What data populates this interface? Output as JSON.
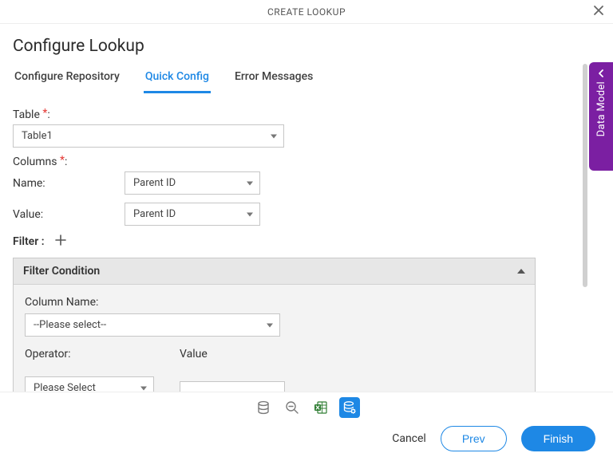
{
  "titlebar": {
    "title": "CREATE LOOKUP"
  },
  "page": {
    "title": "Configure Lookup"
  },
  "tabs": [
    {
      "label": "Configure Repository"
    },
    {
      "label": "Quick Config"
    },
    {
      "label": "Error Messages"
    }
  ],
  "fields": {
    "table_label": "Table",
    "table_value": "Table1",
    "columns_label": "Columns",
    "name_label": "Name:",
    "name_value": "Parent ID",
    "value_label": "Value:",
    "value_value": "Parent ID"
  },
  "filter": {
    "heading": "Filter :",
    "panel_title": "Filter Condition",
    "column_label": "Column Name:",
    "column_value": "--Please select--",
    "operator_label": "Operator:",
    "operator_value": "Please Select",
    "value_label": "Value",
    "value_value": ""
  },
  "footer": {
    "cancel": "Cancel",
    "prev": "Prev",
    "finish": "Finish"
  },
  "side": {
    "label": "Data Model"
  },
  "colors": {
    "accent": "#1e88e5",
    "side": "#7b1fa2",
    "required": "#e53935"
  }
}
